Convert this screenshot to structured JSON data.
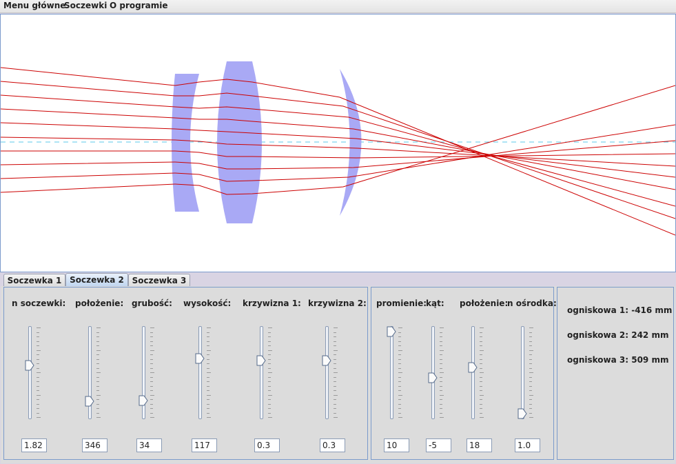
{
  "menu": [
    "Menu główne",
    "Soczewki",
    "O programie"
  ],
  "tabs": [
    "Soczewka 1",
    "Soczewka 2",
    "Soczewka 3"
  ],
  "active_tab": 1,
  "lens_sliders": [
    {
      "label": "n soczewki:",
      "value": "1.82",
      "level": 0.59
    },
    {
      "label": "położenie:",
      "value": "346",
      "level": 0.15
    },
    {
      "label": "grubość:",
      "value": "34",
      "level": 0.16
    },
    {
      "label": "wysokość:",
      "value": "117",
      "level": 0.67
    },
    {
      "label": "krzywizna 1:",
      "value": "0.3",
      "level": 0.65
    },
    {
      "label": "krzywizna 2:",
      "value": "0.3",
      "level": 0.65
    }
  ],
  "beam_sliders": [
    {
      "label": "promienie:",
      "value": "10",
      "level": 1.0
    },
    {
      "label": "kąt:",
      "value": "-5",
      "level": 0.44
    },
    {
      "label": "położenie:",
      "value": "18",
      "level": 0.56
    },
    {
      "label": "n ośrodka:",
      "value": "1.0",
      "level": 0.0
    }
  ],
  "focal_lengths": [
    "ogniskowa 1: -416 mm",
    "ogniskowa 2: 242 mm",
    "ogniskowa 3: 509 mm"
  ],
  "colors": {
    "lens": "#a9a9f5",
    "ray": "#cc0000",
    "axis": "#58c8e8",
    "frame": "#7a9acb"
  }
}
